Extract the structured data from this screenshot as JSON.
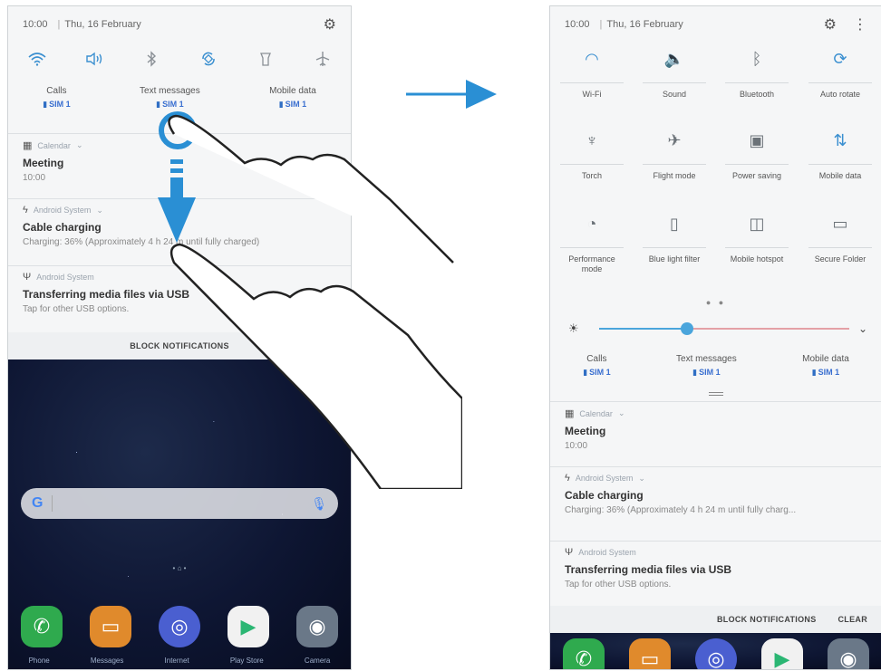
{
  "left": {
    "status": {
      "time": "10:00",
      "date": "Thu, 16 February"
    },
    "quick_icons": [
      {
        "name": "wifi-icon",
        "glyph": "◠",
        "on": true
      },
      {
        "name": "sound-icon",
        "glyph": "🔈",
        "on": true
      },
      {
        "name": "bluetooth-icon",
        "glyph": "ᛒ",
        "on": false
      },
      {
        "name": "auto-rotate-icon",
        "glyph": "⟳",
        "on": true
      },
      {
        "name": "torch-icon",
        "glyph": "♆",
        "on": false
      },
      {
        "name": "airplane-icon",
        "glyph": "✈",
        "on": false
      }
    ],
    "sim": [
      {
        "label": "Calls",
        "value": "SIM 1"
      },
      {
        "label": "Text messages",
        "value": "SIM 1"
      },
      {
        "label": "Mobile data",
        "value": "SIM 1"
      }
    ],
    "notifications": [
      {
        "app": "Calendar",
        "title": "Meeting",
        "body": "10:00"
      },
      {
        "app": "Android System",
        "title": "Cable charging",
        "body": "Charging: 36% (Approximately 4 h 24 m until fully charged)"
      },
      {
        "app": "Android System",
        "title": "Transferring media files via USB",
        "body": "Tap for other USB options."
      }
    ],
    "block_label": "BLOCK NOTIFICATIONS",
    "dock_apps": [
      "Phone",
      "Messages",
      "Internet",
      "Play Store",
      "Camera"
    ]
  },
  "right": {
    "status": {
      "time": "10:00",
      "date": "Thu, 16 February"
    },
    "tiles": [
      {
        "name": "wifi-icon",
        "glyph": "◠",
        "label": "Wi-Fi",
        "on": true
      },
      {
        "name": "sound-icon",
        "glyph": "🔈",
        "label": "Sound",
        "on": true
      },
      {
        "name": "bluetooth-icon",
        "glyph": "ᛒ",
        "label": "Bluetooth",
        "on": false
      },
      {
        "name": "auto-rotate-icon",
        "glyph": "⟳",
        "label": "Auto rotate",
        "on": true
      },
      {
        "name": "torch-icon",
        "glyph": "♆",
        "label": "Torch",
        "on": false
      },
      {
        "name": "airplane-icon",
        "glyph": "✈",
        "label": "Flight mode",
        "on": false
      },
      {
        "name": "power-saving-icon",
        "glyph": "▣",
        "label": "Power saving",
        "on": false
      },
      {
        "name": "mobile-data-icon",
        "glyph": "⇅",
        "label": "Mobile data",
        "on": true
      },
      {
        "name": "performance-mode-icon",
        "glyph": "◔",
        "label": "Performance mode",
        "on": false
      },
      {
        "name": "blue-light-filter-icon",
        "glyph": "▯",
        "label": "Blue light filter",
        "on": false
      },
      {
        "name": "mobile-hotspot-icon",
        "glyph": "◫",
        "label": "Mobile hotspot",
        "on": false
      },
      {
        "name": "secure-folder-icon",
        "glyph": "▭",
        "label": "Secure Folder",
        "on": false
      }
    ],
    "brightness": 0.35,
    "sim": [
      {
        "label": "Calls",
        "value": "SIM 1"
      },
      {
        "label": "Text messages",
        "value": "SIM 1"
      },
      {
        "label": "Mobile data",
        "value": "SIM 1"
      }
    ],
    "notifications": [
      {
        "app": "Calendar",
        "title": "Meeting",
        "body": "10:00"
      },
      {
        "app": "Android System",
        "title": "Cable charging",
        "body": "Charging: 36% (Approximately 4 h 24 m until fully charg..."
      },
      {
        "app": "Android System",
        "title": "Transferring media files via USB",
        "body": "Tap for other USB options."
      }
    ],
    "block_label": "BLOCK NOTIFICATIONS",
    "clear_label": "CLEAR",
    "dock_apps": [
      "Phone",
      "Messages",
      "Internet",
      "Play Store",
      "Camera"
    ]
  },
  "colors": {
    "accent": "#3a8fd0",
    "arrow": "#2a8fd4"
  }
}
